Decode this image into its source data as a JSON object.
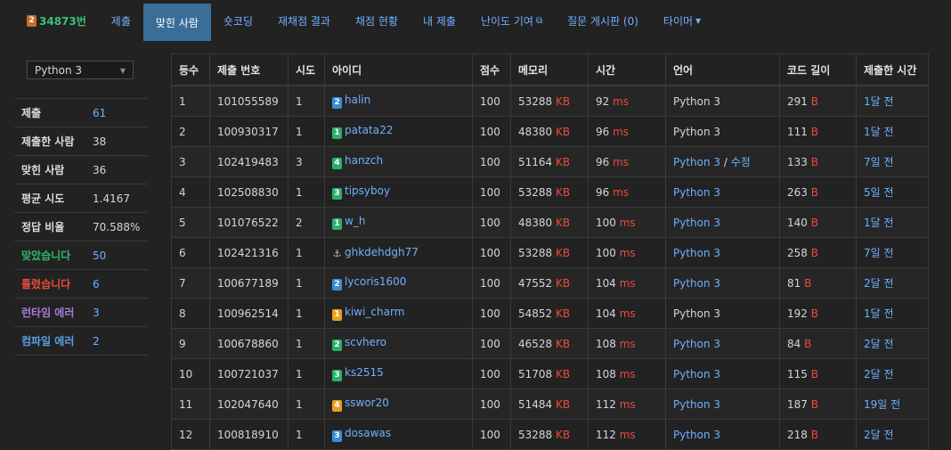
{
  "nav": {
    "problem_number": "34873번",
    "problem_tier": "2",
    "items": [
      "제출",
      "맞힌 사람",
      "숏코딩",
      "재채점 결과",
      "채점 현황",
      "내 제출",
      "난이도 기여",
      "질문 게시판 (0)",
      "타이머"
    ],
    "active_index": 1
  },
  "sidebar": {
    "language": "Python 3",
    "stats": [
      {
        "label": "제출",
        "value": "61",
        "style": "link"
      },
      {
        "label": "제출한 사람",
        "value": "38",
        "style": "plain"
      },
      {
        "label": "맞힌 사람",
        "value": "36",
        "style": "plain"
      },
      {
        "label": "평균 시도",
        "value": "1.4167",
        "style": "plain"
      },
      {
        "label": "정답 비율",
        "value": "70.588%",
        "style": "plain"
      },
      {
        "label": "맞았습니다",
        "value": "50",
        "style": "green"
      },
      {
        "label": "틀렸습니다",
        "value": "6",
        "style": "red"
      },
      {
        "label": "런타임 에러",
        "value": "3",
        "style": "purple"
      },
      {
        "label": "컴파일 에러",
        "value": "2",
        "style": "blue"
      }
    ]
  },
  "table": {
    "headers": [
      "등수",
      "제출 번호",
      "시도",
      "아이디",
      "점수",
      "메모리",
      "시간",
      "언어",
      "코드 길이",
      "제출한 시간"
    ],
    "rows": [
      {
        "rank": "1",
        "id": "101055589",
        "try": "1",
        "tier": "2",
        "tier_color": "#3a8fd6",
        "user": "halin",
        "score": "100",
        "mem": "53288",
        "mem_unit": "KB",
        "time": "92",
        "time_unit": "ms",
        "lang": "Python 3",
        "lang_link": false,
        "lang_extra": "",
        "len": "291",
        "len_unit": "B",
        "when": "1달 전"
      },
      {
        "rank": "2",
        "id": "100930317",
        "try": "1",
        "tier": "1",
        "tier_color": "#2bb06a",
        "user": "patata22",
        "score": "100",
        "mem": "48380",
        "mem_unit": "KB",
        "time": "96",
        "time_unit": "ms",
        "lang": "Python 3",
        "lang_link": false,
        "lang_extra": "",
        "len": "111",
        "len_unit": "B",
        "when": "1달 전"
      },
      {
        "rank": "3",
        "id": "102419483",
        "try": "3",
        "tier": "4",
        "tier_color": "#2bb06a",
        "user": "hanzch",
        "score": "100",
        "mem": "51164",
        "mem_unit": "KB",
        "time": "96",
        "time_unit": "ms",
        "lang": "Python 3",
        "lang_link": true,
        "lang_extra": "수정",
        "len": "133",
        "len_unit": "B",
        "when": "7일 전"
      },
      {
        "rank": "4",
        "id": "102508830",
        "try": "1",
        "tier": "3",
        "tier_color": "#2bb06a",
        "user": "tipsyboy",
        "score": "100",
        "mem": "53288",
        "mem_unit": "KB",
        "time": "96",
        "time_unit": "ms",
        "lang": "Python 3",
        "lang_link": true,
        "lang_extra": "",
        "len": "263",
        "len_unit": "B",
        "when": "5일 전"
      },
      {
        "rank": "5",
        "id": "101076522",
        "try": "2",
        "tier": "1",
        "tier_color": "#2bb06a",
        "user": "w_h",
        "score": "100",
        "mem": "48380",
        "mem_unit": "KB",
        "time": "100",
        "time_unit": "ms",
        "lang": "Python 3",
        "lang_link": true,
        "lang_extra": "",
        "len": "140",
        "len_unit": "B",
        "when": "1달 전"
      },
      {
        "rank": "6",
        "id": "102421316",
        "try": "1",
        "tier": "⚓",
        "tier_color": "transparent",
        "user": "ghkdehdgh77",
        "score": "100",
        "mem": "53288",
        "mem_unit": "KB",
        "time": "100",
        "time_unit": "ms",
        "lang": "Python 3",
        "lang_link": true,
        "lang_extra": "",
        "len": "258",
        "len_unit": "B",
        "when": "7일 전"
      },
      {
        "rank": "7",
        "id": "100677189",
        "try": "1",
        "tier": "2",
        "tier_color": "#3a8fd6",
        "user": "lycoris1600",
        "score": "100",
        "mem": "47552",
        "mem_unit": "KB",
        "time": "104",
        "time_unit": "ms",
        "lang": "Python 3",
        "lang_link": true,
        "lang_extra": "",
        "len": "81",
        "len_unit": "B",
        "when": "2달 전"
      },
      {
        "rank": "8",
        "id": "100962514",
        "try": "1",
        "tier": "1",
        "tier_color": "#e6a020",
        "user": "kiwi_charm",
        "score": "100",
        "mem": "54852",
        "mem_unit": "KB",
        "time": "104",
        "time_unit": "ms",
        "lang": "Python 3",
        "lang_link": false,
        "lang_extra": "",
        "len": "192",
        "len_unit": "B",
        "when": "1달 전"
      },
      {
        "rank": "9",
        "id": "100678860",
        "try": "1",
        "tier": "2",
        "tier_color": "#2bb06a",
        "user": "scvhero",
        "score": "100",
        "mem": "46528",
        "mem_unit": "KB",
        "time": "108",
        "time_unit": "ms",
        "lang": "Python 3",
        "lang_link": true,
        "lang_extra": "",
        "len": "84",
        "len_unit": "B",
        "when": "2달 전"
      },
      {
        "rank": "10",
        "id": "100721037",
        "try": "1",
        "tier": "3",
        "tier_color": "#2bb06a",
        "user": "ks2515",
        "score": "100",
        "mem": "51708",
        "mem_unit": "KB",
        "time": "108",
        "time_unit": "ms",
        "lang": "Python 3",
        "lang_link": true,
        "lang_extra": "",
        "len": "115",
        "len_unit": "B",
        "when": "2달 전"
      },
      {
        "rank": "11",
        "id": "102047640",
        "try": "1",
        "tier": "4",
        "tier_color": "#e6a020",
        "user": "sswor20",
        "score": "100",
        "mem": "51484",
        "mem_unit": "KB",
        "time": "112",
        "time_unit": "ms",
        "lang": "Python 3",
        "lang_link": true,
        "lang_extra": "",
        "len": "187",
        "len_unit": "B",
        "when": "19일 전"
      },
      {
        "rank": "12",
        "id": "100818910",
        "try": "1",
        "tier": "3",
        "tier_color": "#3a8fd6",
        "user": "dosawas",
        "score": "100",
        "mem": "53288",
        "mem_unit": "KB",
        "time": "112",
        "time_unit": "ms",
        "lang": "Python 3",
        "lang_link": true,
        "lang_extra": "",
        "len": "218",
        "len_unit": "B",
        "when": "2달 전"
      }
    ]
  }
}
